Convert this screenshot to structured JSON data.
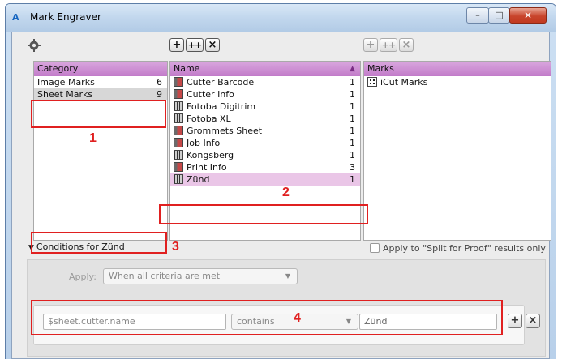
{
  "window": {
    "title": "Mark Engraver",
    "app_icon": "A",
    "controls": {
      "minimize": "–",
      "maximize": "□",
      "close": "✕"
    }
  },
  "toolbar": {
    "add": "+",
    "add_multiple": "++",
    "remove": "×",
    "marks_add": "+",
    "marks_add_multiple": "++",
    "marks_remove": "×"
  },
  "category_pane": {
    "header": "Category",
    "items": [
      {
        "label": "Image Marks",
        "count": "6"
      },
      {
        "label": "Sheet Marks",
        "count": "9"
      }
    ]
  },
  "name_pane": {
    "header": "Name",
    "sort_indicator": "▲",
    "items": [
      {
        "label": "Cutter Barcode",
        "count": "1",
        "icon": "red"
      },
      {
        "label": "Cutter Info",
        "count": "1",
        "icon": "red"
      },
      {
        "label": "Fotoba Digitrim",
        "count": "1",
        "icon": "bars"
      },
      {
        "label": "Fotoba XL",
        "count": "1",
        "icon": "bars"
      },
      {
        "label": "Grommets Sheet",
        "count": "1",
        "icon": "red"
      },
      {
        "label": "Job Info",
        "count": "1",
        "icon": "red"
      },
      {
        "label": "Kongsberg",
        "count": "1",
        "icon": "bars"
      },
      {
        "label": "Print Info",
        "count": "3",
        "icon": "red"
      },
      {
        "label": "Zünd",
        "count": "1",
        "icon": "bars"
      }
    ]
  },
  "marks_pane": {
    "header": "Marks",
    "items": [
      {
        "label": "iCut Marks"
      }
    ]
  },
  "conditions": {
    "toggle_label": "Conditions for Zünd",
    "apply_label": "Apply:",
    "apply_value": "When all criteria are met",
    "split_checkbox_label": "Apply to \"Split for Proof\" results only",
    "criterion": {
      "variable": "$sheet.cutter.name",
      "operator": "contains",
      "value": "Zünd"
    },
    "add_button": "+",
    "remove_button": "×"
  },
  "annotations": {
    "n1": "1",
    "n2": "2",
    "n3": "3",
    "n4": "4",
    "color": "#e02020"
  }
}
